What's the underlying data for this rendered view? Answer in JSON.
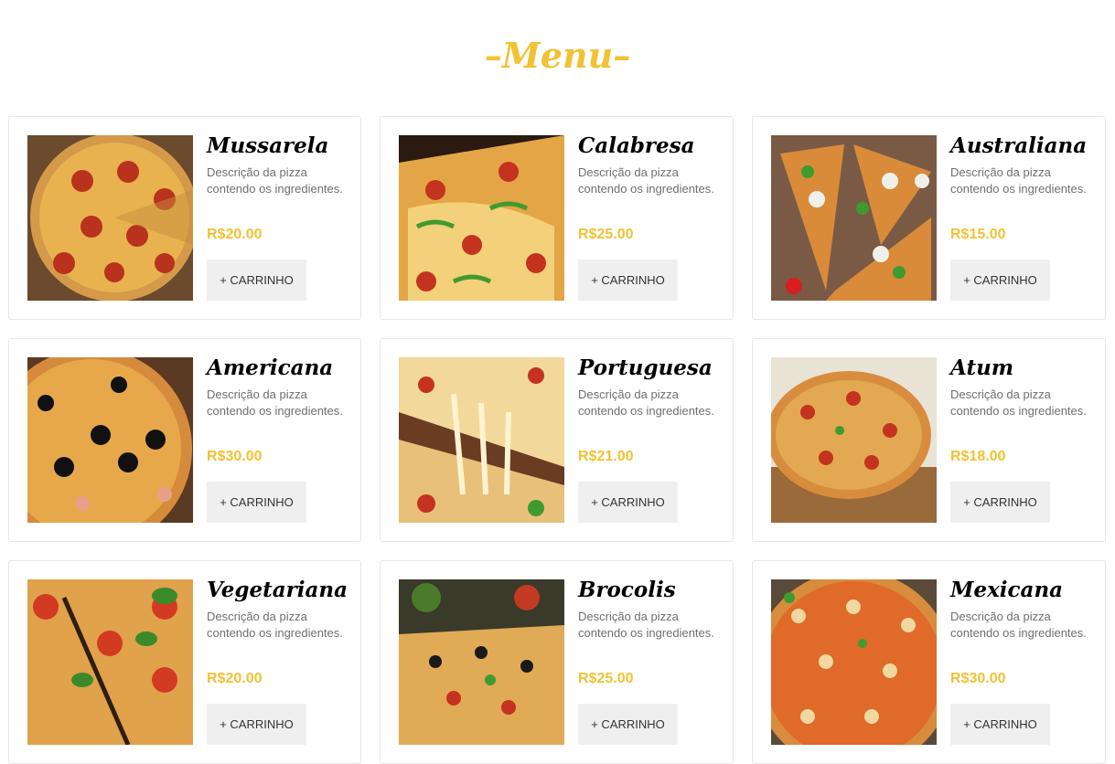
{
  "menu": {
    "title": "–Menu–"
  },
  "currency_color": "#f1c232",
  "pizzas": [
    {
      "name": "Mussarela",
      "description": "Descrição da pizza contendo os ingredientes.",
      "price": "R$20.00",
      "button": "+ CARRINHO"
    },
    {
      "name": "Calabresa",
      "description": "Descrição da pizza contendo os ingredientes.",
      "price": "R$25.00",
      "button": "+ CARRINHO"
    },
    {
      "name": "Australiana",
      "description": "Descrição da pizza contendo os ingredientes.",
      "price": "R$15.00",
      "button": "+ CARRINHO"
    },
    {
      "name": "Americana",
      "description": "Descrição da pizza contendo os ingredientes.",
      "price": "R$30.00",
      "button": "+ CARRINHO"
    },
    {
      "name": "Portuguesa",
      "description": "Descrição da pizza contendo os ingredientes.",
      "price": "R$21.00",
      "button": "+ CARRINHO"
    },
    {
      "name": "Atum",
      "description": "Descrição da pizza contendo os ingredientes.",
      "price": "R$18.00",
      "button": "+ CARRINHO"
    },
    {
      "name": "Vegetariana",
      "description": "Descrição da pizza contendo os ingredientes.",
      "price": "R$20.00",
      "button": "+ CARRINHO"
    },
    {
      "name": "Brocolis",
      "description": "Descrição da pizza contendo os ingredientes.",
      "price": "R$25.00",
      "button": "+ CARRINHO"
    },
    {
      "name": "Mexicana",
      "description": "Descrição da pizza contendo os ingredientes.",
      "price": "R$30.00",
      "button": "+ CARRINHO"
    }
  ]
}
